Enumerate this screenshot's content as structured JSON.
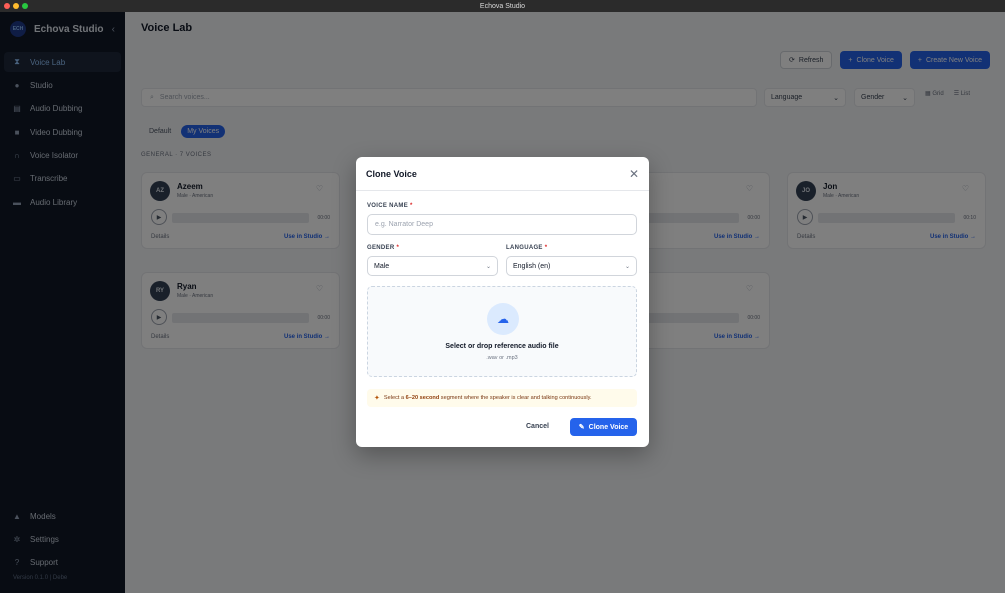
{
  "window": {
    "title": "Echova Studio"
  },
  "sidebar": {
    "brand": "Echova Studio",
    "logo_text": "ECH",
    "items": [
      {
        "label": "Voice Lab",
        "icon": "waveform-icon",
        "glyph": "⧗"
      },
      {
        "label": "Studio",
        "icon": "mic-icon",
        "glyph": "🎙"
      },
      {
        "label": "Audio Dubbing",
        "icon": "file-audio-icon",
        "glyph": "▤"
      },
      {
        "label": "Video Dubbing",
        "icon": "video-icon",
        "glyph": "■"
      },
      {
        "label": "Voice Isolator",
        "icon": "headphones-icon",
        "glyph": "∩"
      },
      {
        "label": "Transcribe",
        "icon": "transcribe-icon",
        "glyph": "▭"
      },
      {
        "label": "Audio Library",
        "icon": "folder-icon",
        "glyph": "▬"
      }
    ],
    "bottom_items": [
      {
        "label": "Models",
        "icon": "models-icon",
        "glyph": "▲"
      },
      {
        "label": "Settings",
        "icon": "gear-icon",
        "glyph": "✲"
      },
      {
        "label": "Support",
        "icon": "help-icon",
        "glyph": "?"
      }
    ],
    "version": "Version 0.1.0 | Debe"
  },
  "main": {
    "title": "Voice Lab",
    "refresh_label": "Refresh",
    "clone_label": "Clone Voice",
    "create_label": "Create New Voice",
    "search_placeholder": "Search voices...",
    "language_filter": "Language",
    "gender_filter": "Gender",
    "view_grid": "Grid",
    "view_list": "List",
    "tabs": {
      "default": "Default",
      "mine": "My Voices"
    },
    "section_label": "GENERAL · 7 VOICES",
    "cards": [
      {
        "initials": "AZ",
        "name": "Azeem",
        "meta": "Male · American",
        "duration": "00:00",
        "details": "Details",
        "use": "Use in Studio →"
      },
      {
        "initials": "",
        "name": "",
        "meta": "",
        "duration": "00:00",
        "details": "Details",
        "use": "Use in Studio →"
      },
      {
        "initials": "JO",
        "name": "Jon",
        "meta": "Male · American",
        "duration": "00:10",
        "details": "Details",
        "use": "Use in Studio →"
      },
      {
        "initials": "RY",
        "name": "Ryan",
        "meta": "Male · American",
        "duration": "00:00",
        "details": "Details",
        "use": "Use in Studio →"
      },
      {
        "initials": "",
        "name": "",
        "meta": "",
        "duration": "00:00",
        "details": "Details",
        "use": "Use in Studio →"
      }
    ]
  },
  "modal": {
    "title": "Clone Voice",
    "voice_name_label": "VOICE NAME",
    "voice_name_placeholder": "e.g. Narrator Deep",
    "gender_label": "GENDER",
    "gender_value": "Male",
    "language_label": "LANGUAGE",
    "language_value": "English (en)",
    "required_mark": "*",
    "drop_title": "Select or drop reference audio file",
    "drop_sub": ".wav or .mp3",
    "tip_pre": "Select a ",
    "tip_bold": "6–20 second",
    "tip_post": " segment where the speaker is clear and talking continuously.",
    "cancel_label": "Cancel",
    "submit_label": "Clone Voice"
  },
  "colors": {
    "accent": "#2563eb",
    "sidebar_bg": "#111827",
    "tip_bg": "#fffbeb"
  }
}
